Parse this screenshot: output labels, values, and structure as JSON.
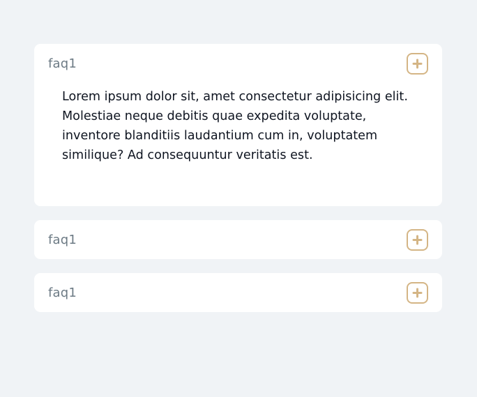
{
  "faq": {
    "items": [
      {
        "title": "faq1",
        "expanded": true,
        "answer": "Lorem ipsum dolor sit, amet consectetur adipisicing elit. Molestiae neque debitis quae expedita voluptate, inventore blanditiis laudantium cum in, voluptatem similique? Ad consequuntur veritatis est.",
        "toggle_icon": "plus-icon"
      },
      {
        "title": "faq1",
        "expanded": false,
        "toggle_icon": "plus-icon"
      },
      {
        "title": "faq1",
        "expanded": false,
        "toggle_icon": "plus-icon"
      }
    ]
  },
  "colors": {
    "page_background": "#f0f3f6",
    "card_background": "#ffffff",
    "title_text": "#6c7a84",
    "answer_text": "#0e1420",
    "accent": "#d4b585"
  }
}
